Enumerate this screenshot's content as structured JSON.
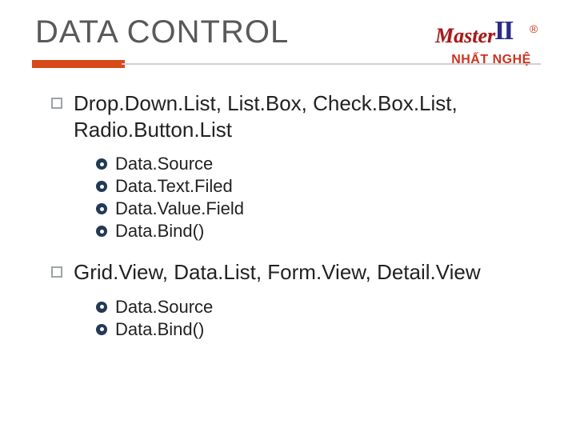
{
  "title": "DATA CONTROL",
  "logo": {
    "master": "Master",
    "ii": "II",
    "r": "®",
    "subtitle": "NHẤT NGHỆ"
  },
  "sections": [
    {
      "heading": "Drop.Down.List, List.Box, Check.Box.List, Radio.Button.List",
      "items": [
        "Data.Source",
        "Data.Text.Filed",
        "Data.Value.Field",
        "Data.Bind()"
      ]
    },
    {
      "heading": "Grid.View, Data.List, Form.View, Detail.View",
      "items": [
        "Data.Source",
        "Data.Bind()"
      ]
    }
  ]
}
